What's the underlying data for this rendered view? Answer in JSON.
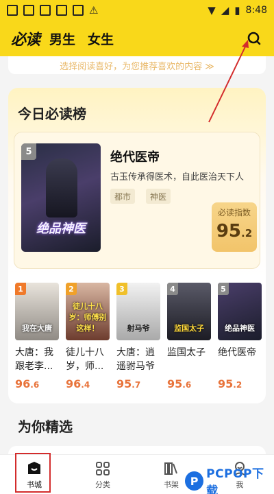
{
  "status_bar": {
    "time": "8:48"
  },
  "header": {
    "logo": "必读",
    "tabs": [
      {
        "label": "男生"
      },
      {
        "label": "女生"
      }
    ]
  },
  "banner": {
    "text": "选择阅读喜好，为您推荐喜欢的内容 ≫"
  },
  "ranking": {
    "title": "今日必读榜",
    "featured": {
      "rank": "5",
      "cover_text": "绝品神医",
      "title": "绝代医帝",
      "description": "古玉传承得医术，自此医治天下人",
      "tags": [
        "都市",
        "神医"
      ],
      "score_label": "必读指数",
      "score_int": "95",
      "score_dec": ".2"
    },
    "books": [
      {
        "rank": "1",
        "cover_text": "我在大唐",
        "name": "大唐：我跟老李...",
        "score_int": "96",
        "score_dec": ".6",
        "badge_color": "#f07a2a",
        "cover_color": "#b9b0a6"
      },
      {
        "rank": "2",
        "cover_text": "徒儿十八岁：师傅别这样！",
        "name": "徒儿十八岁，师...",
        "score_int": "96",
        "score_dec": ".4",
        "badge_color": "#f0a12a",
        "cover_color": "#8a5a48"
      },
      {
        "rank": "3",
        "cover_text": "射马爷",
        "name": "大唐：逍遥驸马爷",
        "score_int": "95",
        "score_dec": ".7",
        "badge_color": "#f0c02a",
        "cover_color": "#d8d8d8"
      },
      {
        "rank": "4",
        "cover_text": "监国太子",
        "name": "监国太子",
        "score_int": "95",
        "score_dec": ".6",
        "badge_color": "#8a8a8a",
        "cover_color": "#3a3a44"
      },
      {
        "rank": "5",
        "cover_text": "绝品神医",
        "name": "绝代医帝",
        "score_int": "95",
        "score_dec": ".2",
        "badge_color": "#8a8a8a",
        "cover_color": "#3b3553"
      }
    ]
  },
  "section": {
    "title": "为你精选"
  },
  "bottom_nav": [
    {
      "label": "书城",
      "icon": "bookstore-icon"
    },
    {
      "label": "分类",
      "icon": "category-icon"
    },
    {
      "label": "书架",
      "icon": "bookshelf-icon"
    },
    {
      "label": "我",
      "icon": "profile-icon"
    }
  ],
  "watermark": {
    "letter": "P",
    "text": "PCPOP下载"
  },
  "colors": {
    "accent_yellow": "#f9d81a",
    "score_orange": "#e8733a",
    "highlight_red": "#d32c2c"
  }
}
